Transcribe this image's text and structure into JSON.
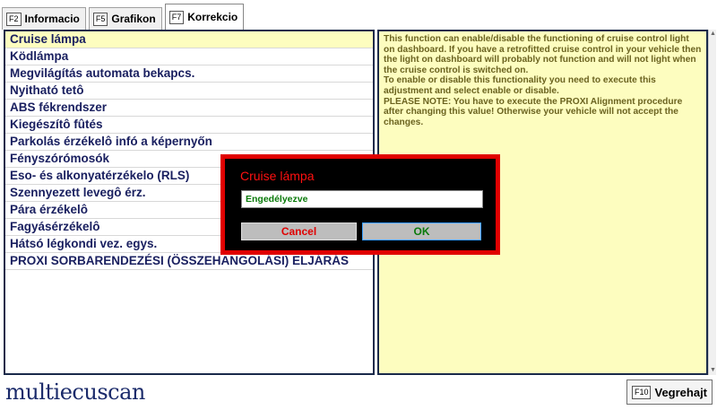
{
  "tabs": [
    {
      "key": "F2",
      "label": "Informacio"
    },
    {
      "key": "F5",
      "label": "Grafikon"
    },
    {
      "key": "F7",
      "label": "Korrekcio"
    }
  ],
  "list": {
    "selected_index": 0,
    "items": [
      "Cruise lámpa",
      "Ködlámpa",
      "Megvilágítás automata bekapcs.",
      "Nyitható tetô",
      "ABS fékrendszer",
      "Kiegészítô fûtés",
      "Parkolás érzékelô infó a képernyőn",
      "Fényszórómosók",
      "Eso- és alkonyatérzékelo (RLS)",
      "Szennyezett levegô érz.",
      "Pára érzékelô",
      "Fagyásérzékelô",
      "Hátsó légkondi vez. egys.",
      "PROXI SORBARENDEZÉSI (ÖSSZEHANGOLÁSI) ELJÁRÁS"
    ]
  },
  "description": "This function can enable/disable the functioning of cruise control light on dashboard. If you have a retrofitted cruise control in your vehicle then the light on dashboard will probably not function and will not light when the cruise control is switched on.\nTo enable or disable this functionality you need to execute this adjustment and select enable or disable.\nPLEASE NOTE: You have to execute the PROXI Alignment procedure after changing this value! Otherwise your vehicle will not accept the changes.",
  "logo": "multiecuscan",
  "execute": {
    "key": "F10",
    "label": "Vegrehajt"
  },
  "dialog": {
    "title": "Cruise lámpa",
    "value": "Engedélyezve",
    "cancel_label": "Cancel",
    "ok_label": "OK"
  },
  "colors": {
    "list_text": "#1a2060",
    "desc_bg": "#fdfdbf",
    "dialog_border": "#e00000",
    "ok_text": "#0a7a0a"
  }
}
